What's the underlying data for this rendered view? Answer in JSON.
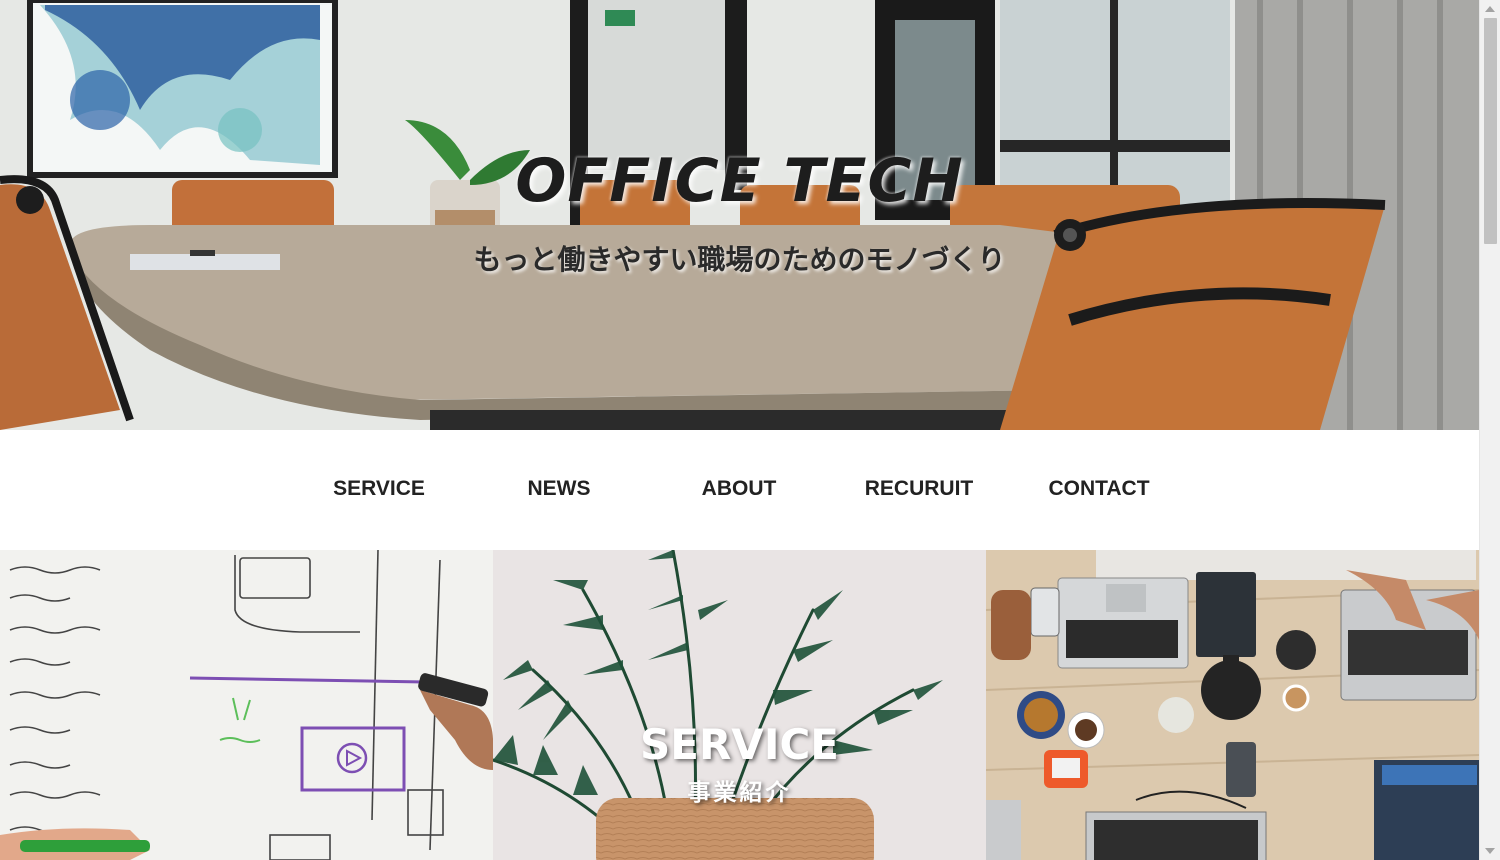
{
  "hero": {
    "title": "OFFICE TECH",
    "subtitle": "もっと働きやすい職場のためのモノづくり"
  },
  "nav": {
    "items": [
      {
        "label": "SERVICE"
      },
      {
        "label": "NEWS"
      },
      {
        "label": "ABOUT"
      },
      {
        "label": "RECURUIT"
      },
      {
        "label": "CONTACT"
      }
    ]
  },
  "tiles": [
    {
      "name": "whiteboard-photo"
    },
    {
      "name": "plant-photo",
      "title": "SERVICE",
      "subtitle": "事業紹介"
    },
    {
      "name": "laptops-photo"
    }
  ],
  "colors": {
    "text": "#222222",
    "chair": "#c2703a",
    "table": "#b7aa99"
  }
}
